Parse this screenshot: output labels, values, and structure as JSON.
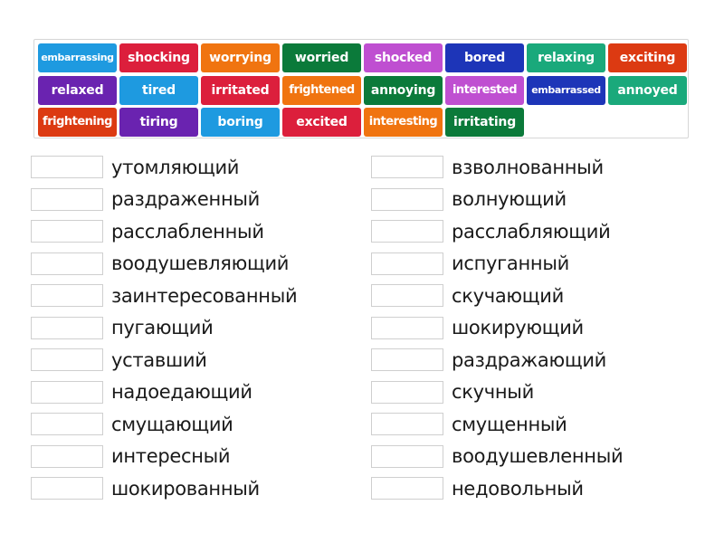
{
  "tiles": [
    {
      "label": "embarrassing",
      "color": "#1e9ae0",
      "size": "small"
    },
    {
      "label": "shocking",
      "color": "#dc1f3c",
      "size": "normal"
    },
    {
      "label": "worrying",
      "color": "#f07410",
      "size": "normal"
    },
    {
      "label": "worried",
      "color": "#0b7a3a",
      "size": "normal"
    },
    {
      "label": "shocked",
      "color": "#bf4fd1",
      "size": "normal"
    },
    {
      "label": "bored",
      "color": "#1d35b8",
      "size": "normal"
    },
    {
      "label": "relaxing",
      "color": "#1aa97b",
      "size": "normal"
    },
    {
      "label": "exciting",
      "color": "#dc3a12",
      "size": "normal"
    },
    {
      "label": "relaxed",
      "color": "#6a23b0",
      "size": "normal"
    },
    {
      "label": "tired",
      "color": "#1e9ae0",
      "size": "normal"
    },
    {
      "label": "irritated",
      "color": "#dc1f3c",
      "size": "normal"
    },
    {
      "label": "frightened",
      "color": "#f07410",
      "size": "medium"
    },
    {
      "label": "annoying",
      "color": "#0b7a3a",
      "size": "normal"
    },
    {
      "label": "interested",
      "color": "#bf4fd1",
      "size": "medium"
    },
    {
      "label": "embarrassed",
      "color": "#1d35b8",
      "size": "small"
    },
    {
      "label": "annoyed",
      "color": "#1aa97b",
      "size": "normal"
    },
    {
      "label": "frightening",
      "color": "#dc3a12",
      "size": "medium"
    },
    {
      "label": "tiring",
      "color": "#6a23b0",
      "size": "normal"
    },
    {
      "label": "boring",
      "color": "#1e9ae0",
      "size": "normal"
    },
    {
      "label": "excited",
      "color": "#dc1f3c",
      "size": "normal"
    },
    {
      "label": "interesting",
      "color": "#f07410",
      "size": "medium"
    },
    {
      "label": "irritating",
      "color": "#0b7a3a",
      "size": "normal"
    }
  ],
  "left_column": [
    "утомляющий",
    "раздраженный",
    "расслабленный",
    "воодушевляющий",
    "заинтересованный",
    "пугающий",
    "уставший",
    "надоедающий",
    "смущающий",
    "интересный",
    "шокированный"
  ],
  "right_column": [
    "взволнованный",
    "волнующий",
    "расслабляющий",
    "испуганный",
    "скучающий",
    "шокирующий",
    "раздражающий",
    "скучный",
    "смущенный",
    "воодушевленный",
    "недовольный"
  ]
}
